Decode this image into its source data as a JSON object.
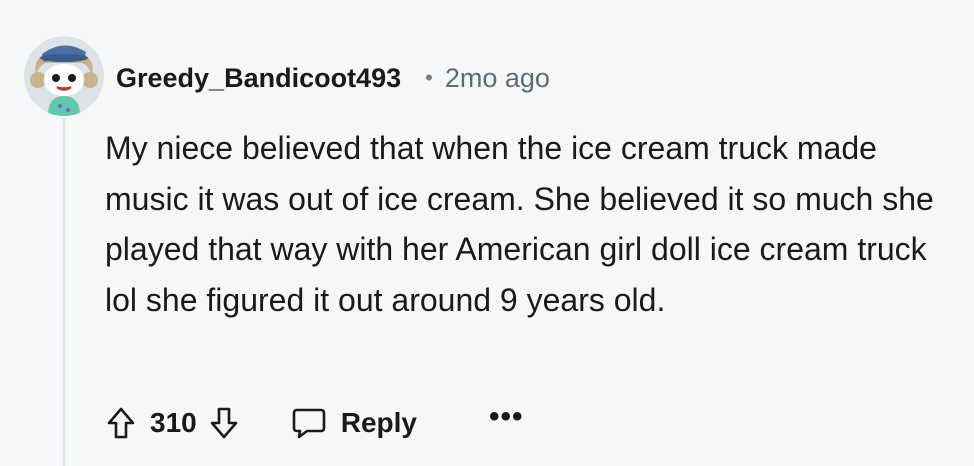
{
  "comment": {
    "username": "Greedy_Bandicoot493",
    "separator": "•",
    "timestamp": "2mo ago",
    "body": "My niece believed that when the ice cream truck made music it was out of ice cream. She believed it so much she played that way with her American girl doll ice cream truck lol she figured it out around 9 years old."
  },
  "actions": {
    "upvote_icon": "arrow-up-outline-icon",
    "vote_count": "310",
    "downvote_icon": "arrow-down-outline-icon",
    "reply_icon": "speech-bubble-icon",
    "reply_label": "Reply",
    "more_label": "•••"
  },
  "colors": {
    "background": "#f6f7f8",
    "text": "#1a1a1b",
    "meta": "#576f76",
    "thread_line": "#dfe3e6"
  }
}
